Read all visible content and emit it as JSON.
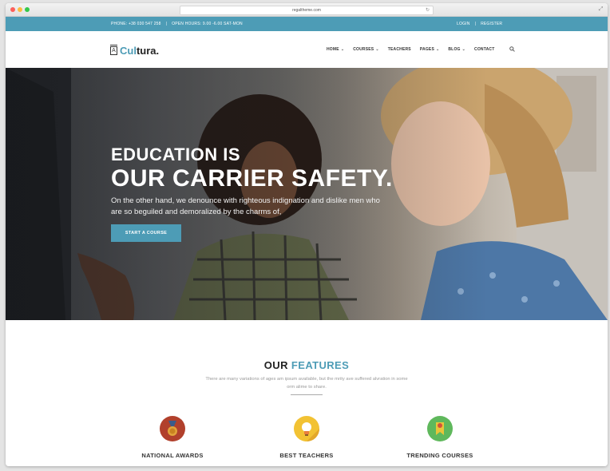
{
  "browser": {
    "url": "regaltheme.com"
  },
  "topbar": {
    "phone": "PHONE: +38 030 547 258",
    "separator": "|",
    "hours": "OPEN HOURS: 9.00 -6.00 SAT-MON",
    "login": "LOGIN",
    "register": "REGISTER"
  },
  "header": {
    "logo_icon_letter": "A",
    "logo_text_accent": "Cul",
    "logo_text_rest": "tura.",
    "nav": [
      {
        "label": "HOME",
        "has_dropdown": true
      },
      {
        "label": "COURSES",
        "has_dropdown": true
      },
      {
        "label": "TEACHERS",
        "has_dropdown": false
      },
      {
        "label": "PAGES",
        "has_dropdown": true
      },
      {
        "label": "BLOG",
        "has_dropdown": true
      },
      {
        "label": "CONTACT",
        "has_dropdown": false
      }
    ],
    "search_icon": "search-icon"
  },
  "hero": {
    "line1": "EDUCATION IS",
    "line2": "OUR CARRIER SAFETY.",
    "description": "On the other hand, we denounce with righteous indignation and dislike men who are so beguiled and demoralized by the charms of,",
    "button_label": "START A COURSE"
  },
  "features": {
    "title_prefix": "OUR",
    "title_accent": "FEATURES",
    "description": "There are many variations of ages am ipsum available, but the mrity ave suffered alvration in some orm alime to share.",
    "items": [
      {
        "label": "NATIONAL AWARDS",
        "icon": "medal-icon",
        "color": "#b1402c"
      },
      {
        "label": "BEST TEACHERS",
        "icon": "lightbulb-icon",
        "color": "#f2c233"
      },
      {
        "label": "TRENDING COURSES",
        "icon": "ribbon-badge-icon",
        "color": "#5fb85c"
      }
    ]
  },
  "colors": {
    "accent": "#4d9cb6",
    "topbar_bg": "#4d9cb6",
    "text_dark": "#222222"
  }
}
